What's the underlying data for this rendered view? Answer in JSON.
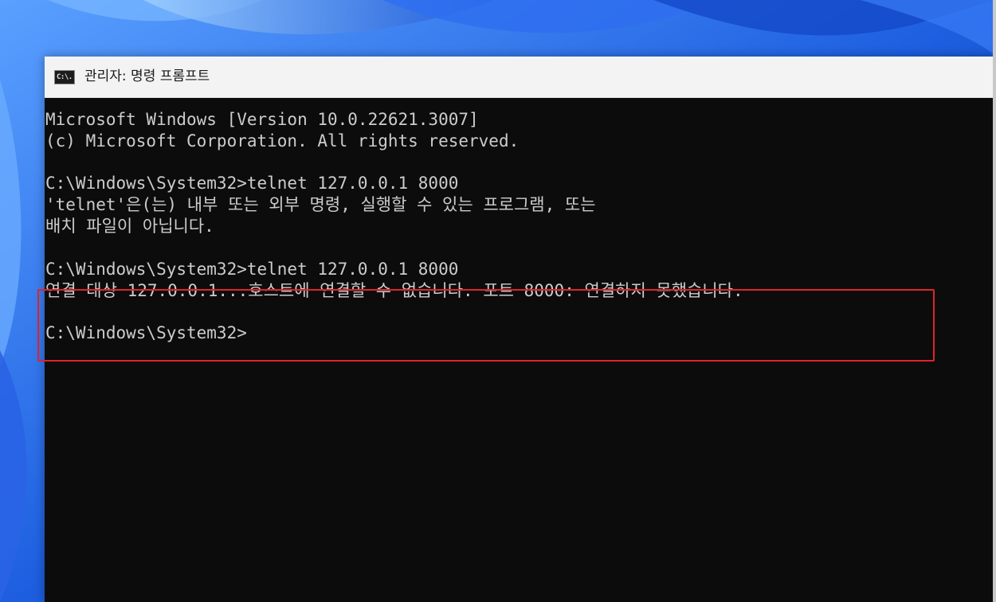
{
  "window": {
    "title": "관리자: 명령 프롬프트",
    "icon": "cmd-icon",
    "icon_text": "C:\\."
  },
  "console": {
    "lines": [
      "Microsoft Windows [Version 10.0.22621.3007]",
      "(c) Microsoft Corporation. All rights reserved.",
      "",
      "C:\\Windows\\System32>telnet 127.0.0.1 8000",
      "'telnet'은(는) 내부 또는 외부 명령, 실행할 수 있는 프로그램, 또는",
      "배치 파일이 아닙니다.",
      "",
      "C:\\Windows\\System32>telnet 127.0.0.1 8000",
      "연결 대상 127.0.0.1...호스트에 연결할 수 없습니다. 포트 8000: 연결하지 못했습니다.",
      "",
      "C:\\Windows\\System32>"
    ]
  },
  "colors": {
    "console_background": "#0c0c0c",
    "console_text": "#cccccc",
    "highlight_border": "#e0232b",
    "titlebar_background": "#f3f3f3"
  }
}
